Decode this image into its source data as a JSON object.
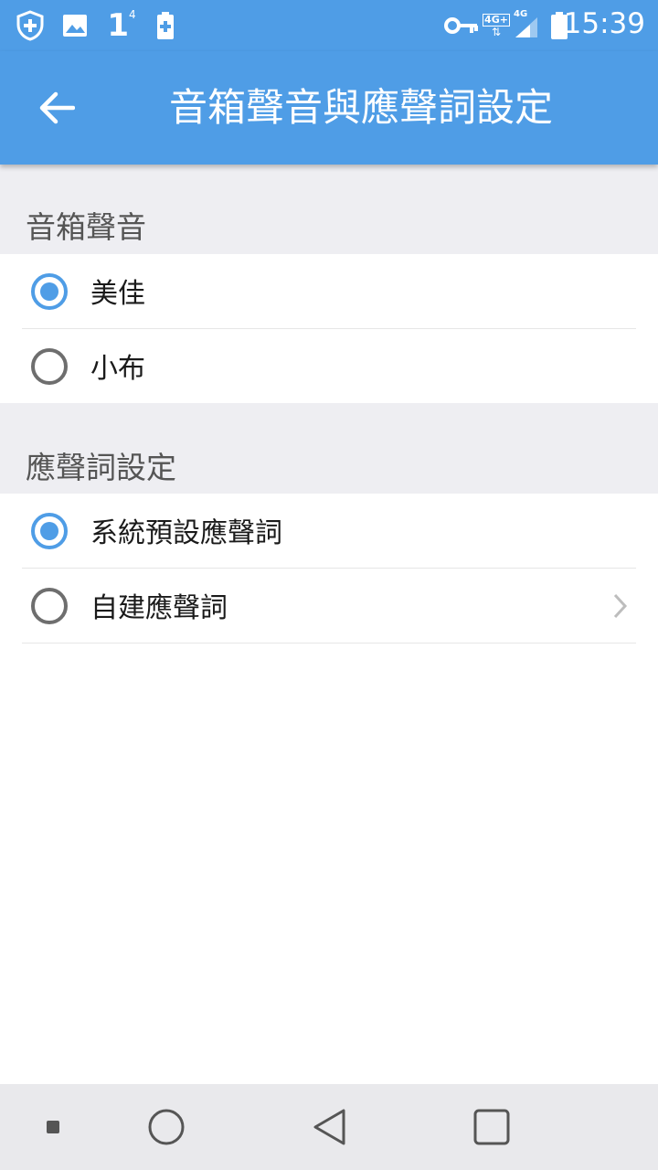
{
  "status_bar": {
    "time": "15:39",
    "notification_count": "1",
    "notification_superscript": "4",
    "network_label_1": "4G+",
    "network_label_2": "4G",
    "icons": [
      "shield-plus-icon",
      "image-icon",
      "number-one-icon",
      "battery-plus-icon",
      "vpn-key-icon",
      "network-4g-plus-icon",
      "signal-icon",
      "battery-icon"
    ]
  },
  "app_bar": {
    "title": "音箱聲音與應聲詞設定",
    "back_icon": "arrow-left-icon"
  },
  "sections": [
    {
      "header": "音箱聲音",
      "options": [
        {
          "label": "美佳",
          "selected": true
        },
        {
          "label": "小布",
          "selected": false
        }
      ]
    },
    {
      "header": "應聲詞設定",
      "options": [
        {
          "label": "系統預設應聲詞",
          "selected": true
        },
        {
          "label": "自建應聲詞",
          "selected": false,
          "has_chevron": true
        }
      ]
    }
  ],
  "nav_bar": {
    "buttons": [
      "small-square-icon",
      "home-circle-icon",
      "back-triangle-icon",
      "recents-square-icon"
    ]
  },
  "colors": {
    "primary": "#4f9de6",
    "section_bg": "#eeeef2",
    "nav_bg": "#e9e9ec"
  }
}
